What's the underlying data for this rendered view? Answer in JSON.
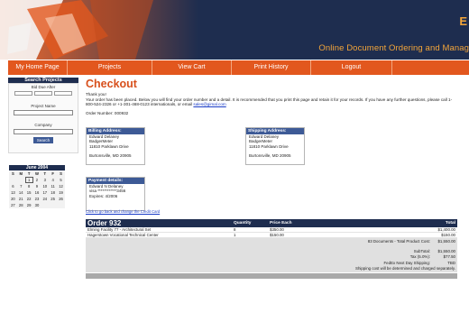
{
  "header": {
    "brand_letter": "E",
    "tagline": "Online Document Ordering and Manag"
  },
  "nav": [
    {
      "label": "My Home Page",
      "active": true
    },
    {
      "label": "Projects"
    },
    {
      "label": "View Cart"
    },
    {
      "label": "Print History"
    },
    {
      "label": "Logout"
    }
  ],
  "search": {
    "title": "Search Projects",
    "bid_due_label": "Bid Due After",
    "project_name_label": "Project Name",
    "company_label": "Company",
    "button": "Search"
  },
  "calendar": {
    "title": "June 2004",
    "days": [
      "S",
      "M",
      "T",
      "W",
      "T",
      "F",
      "S"
    ],
    "weeks": [
      [
        "",
        "",
        "1",
        "2",
        "3",
        "4",
        "5"
      ],
      [
        "6",
        "7",
        "8",
        "9",
        "10",
        "11",
        "12"
      ],
      [
        "13",
        "14",
        "15",
        "16",
        "17",
        "18",
        "19"
      ],
      [
        "20",
        "21",
        "22",
        "23",
        "24",
        "25",
        "26"
      ],
      [
        "27",
        "28",
        "29",
        "30",
        "",
        "",
        ""
      ]
    ],
    "today": "1"
  },
  "main": {
    "title": "Checkout",
    "thank_you": "Thank you!",
    "message": "Your order has been placed. Below you will find your order number and a detail. It is recommended that you print this page and retain it for your records. If you have any further questions, please call 1-800-524-2326 or +1-301-468-0123 internationals, or email",
    "email": "sales@gimal.com",
    "order_number": "Order Number: 000932",
    "billing": {
      "title": "Billing Address:",
      "lines": [
        "Edward Delaney",
        "BadgerMeter",
        "11810 Parklawn Drive",
        "",
        "Burtonsville, MD 20905"
      ]
    },
    "shipping": {
      "title": "Shipping Address:",
      "lines": [
        "Edward Delaney",
        "BadgerMeter",
        "11810 Parklawn Drive",
        "",
        "Burtonsville, MD 20905"
      ]
    },
    "payment": {
      "title": "Payment details:",
      "lines": [
        "Edward N Delaney",
        "visa ************3456",
        "Expires: 4/2006"
      ]
    },
    "change_card": "Click to go back and change the Credit Card"
  },
  "order": {
    "title": "Order 932",
    "col_quantity": "Quantity",
    "col_price": "Price Each",
    "col_total": "Total",
    "items": [
      {
        "name": "Elming Facility 77 - Architectural Set",
        "qty": "8",
        "price": "$350.00",
        "total": "$1,400.00"
      },
      {
        "name": "Hagerstown Vocational Technical Center",
        "qty": "1",
        "price": "$150.00",
        "total": "$150.00"
      }
    ],
    "documents_label": "83 Documents - Total Product Cost:",
    "documents_value": "$1,550.00",
    "subtotal_label": "SubTotal:",
    "subtotal_value": "$1,550.00",
    "tax_label": "Tax (5.0%):",
    "tax_value": "$77.50",
    "shipping_label": "FedEx Next Day Shipping:",
    "shipping_value": "TBD",
    "note": "Shipping cost will be determined and charged separately."
  },
  "colors": {
    "accent": "#e2571e",
    "navy": "#1e2d4f",
    "title": "#d8501c"
  }
}
